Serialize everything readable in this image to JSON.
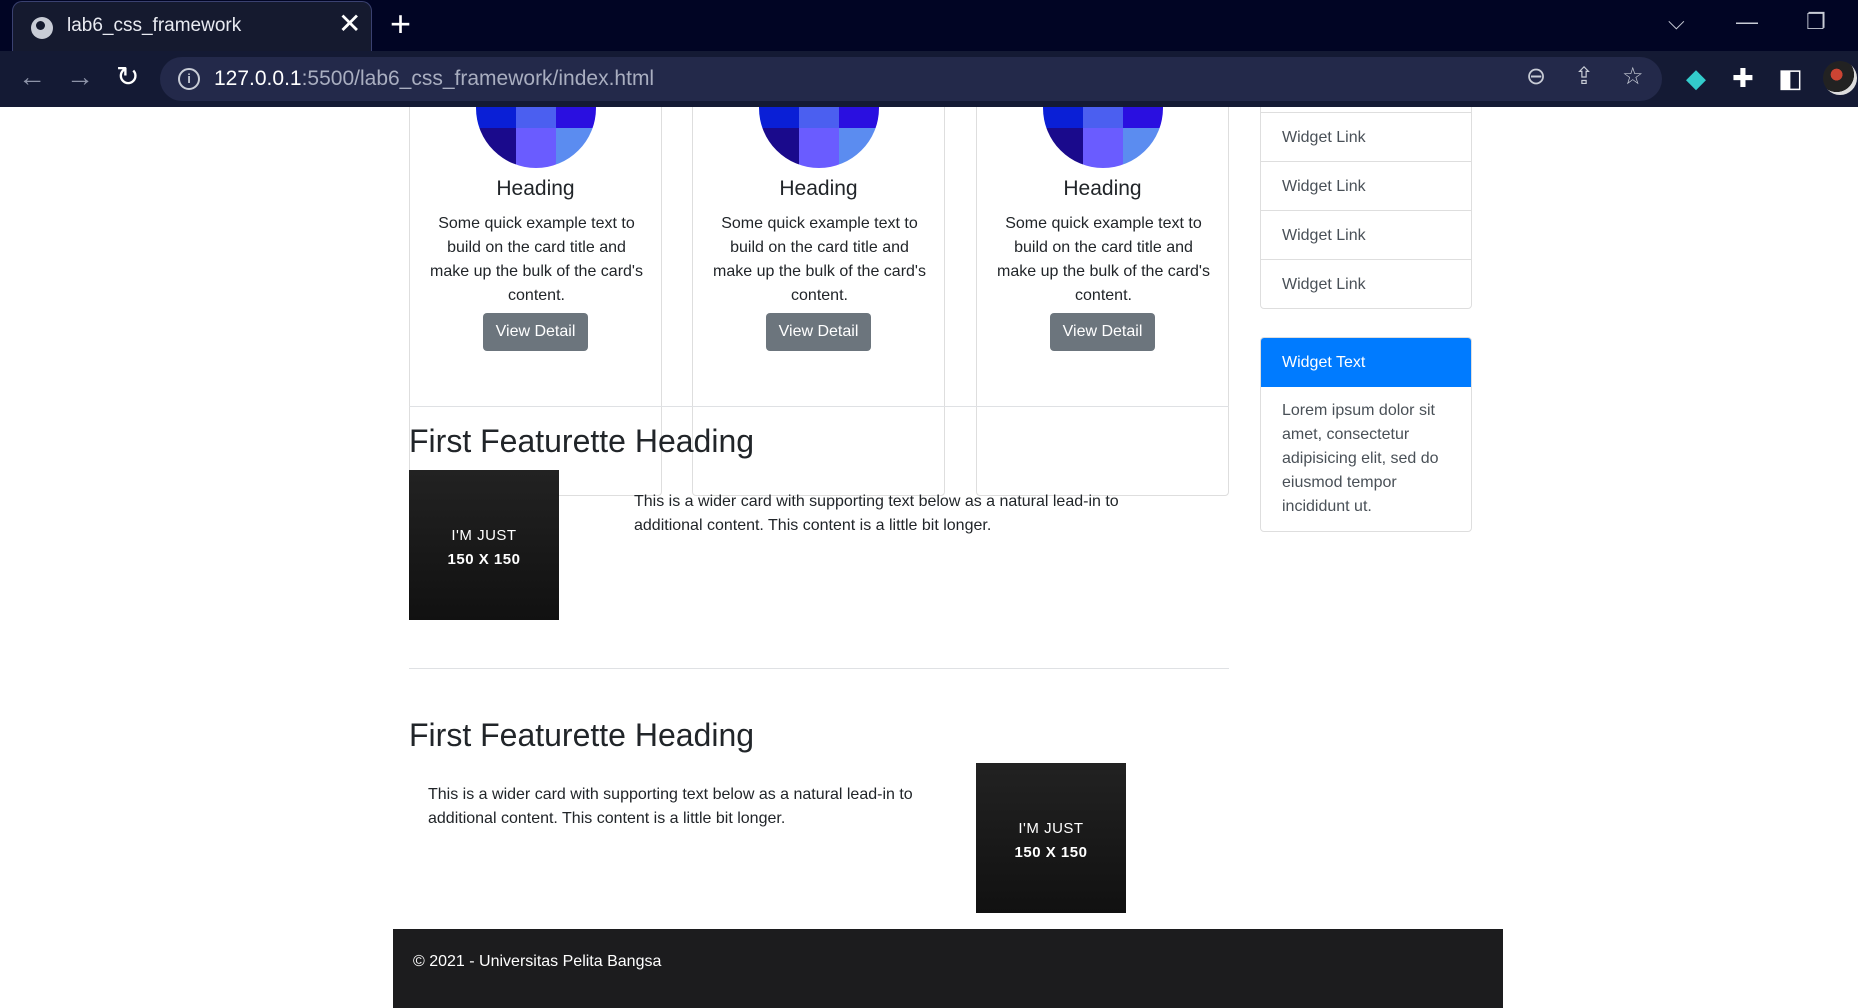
{
  "browser": {
    "tab_title": "lab6_css_framework",
    "tab_close": "✕",
    "new_tab": "+",
    "url_host": "127.0.0.1",
    "url_rest": ":5500/lab6_css_framework/index.html",
    "info_icon": "i"
  },
  "cards": [
    {
      "title": "Heading",
      "text": "Some quick example text to build on the card title and make up the bulk of the card's content.",
      "button": "View Detail"
    },
    {
      "title": "Heading",
      "text": "Some quick example text to build on the card title and make up the bulk of the card's content.",
      "button": "View Detail"
    },
    {
      "title": "Heading",
      "text": "Some quick example text to build on the card title and make up the bulk of the card's content.",
      "button": "View Detail"
    }
  ],
  "featurettes": [
    {
      "heading": "First Featurette Heading",
      "text": "This is a wider card with supporting text below as a natural lead-in to additional content. This content is a little bit longer.",
      "placeholder_line1": "I'M JUST",
      "placeholder_line2": "150 X 150"
    },
    {
      "heading": "First Featurette Heading",
      "text": "This is a wider card with supporting text below as a natural lead-in to additional content. This content is a little bit longer.",
      "placeholder_line1": "I'M JUST",
      "placeholder_line2": "150 X 150"
    }
  ],
  "sidebar": {
    "links": [
      "Widget Link",
      "Widget Link",
      "Widget Link",
      "Widget Link"
    ],
    "widget_title": "Widget Text",
    "widget_body": "Lorem ipsum dolor sit amet, consectetur adipisicing elit, sed do eiusmod tempor incididunt ut."
  },
  "footer": {
    "text": "© 2021 - Universitas Pelita Bangsa"
  },
  "colors": {
    "accent": "#007bff",
    "button": "#6c757d",
    "footer": "#1c1c1e",
    "chrome": "#010524"
  }
}
